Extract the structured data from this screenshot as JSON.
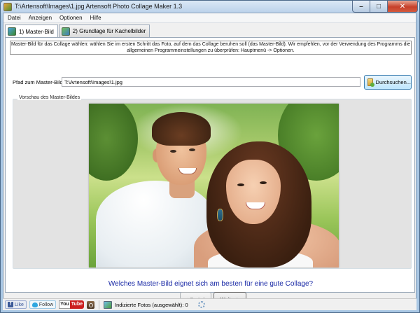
{
  "window": {
    "title": "T:\\Artensoft\\Images\\1.jpg Artensoft Photo Collage Maker 1.3",
    "controls": {
      "minimize": "–",
      "maximize": "□",
      "close": "✕"
    }
  },
  "menu": [
    "Datei",
    "Anzeigen",
    "Optionen",
    "Hilfe"
  ],
  "tabs": [
    {
      "label": "1) Master-Bild",
      "icon": "master-image-icon",
      "active": true
    },
    {
      "label": "2) Grundlage für Kachelbilder",
      "icon": "tile-base-icon",
      "active": false
    }
  ],
  "info": {
    "line1": "Master-Bild für das Collage wählen: wählen Sie im ersten Schritt das Foto, auf dem das Collage beruhen soll (das Master-Bild). Wir empfehlen, vor der Verwendung des Programms die",
    "line2": "allgemeinen Programmeinstellungen zu überprüfen: Hauptmenü -> Optionen."
  },
  "path": {
    "label": "Pfad zum Master-Bild:",
    "value": "T:\\Artensoft\\Images\\1.jpg",
    "browse_label": "Durchsuchen..."
  },
  "preview": {
    "label": "Vorschau des Master-Bildes"
  },
  "question": "Welches Master-Bild eignet sich am besten für eine gute Collage?",
  "nav": {
    "prev_label": "< Zurück",
    "next_label": "Weiter >"
  },
  "statusbar": {
    "like_label": "Like",
    "facebook_mark": "f",
    "follow_label": "Follow",
    "youtube_you": "You",
    "youtube_tube": "Tube",
    "indexed_label": "Indizierte Fotos (ausgewählt): 0"
  }
}
